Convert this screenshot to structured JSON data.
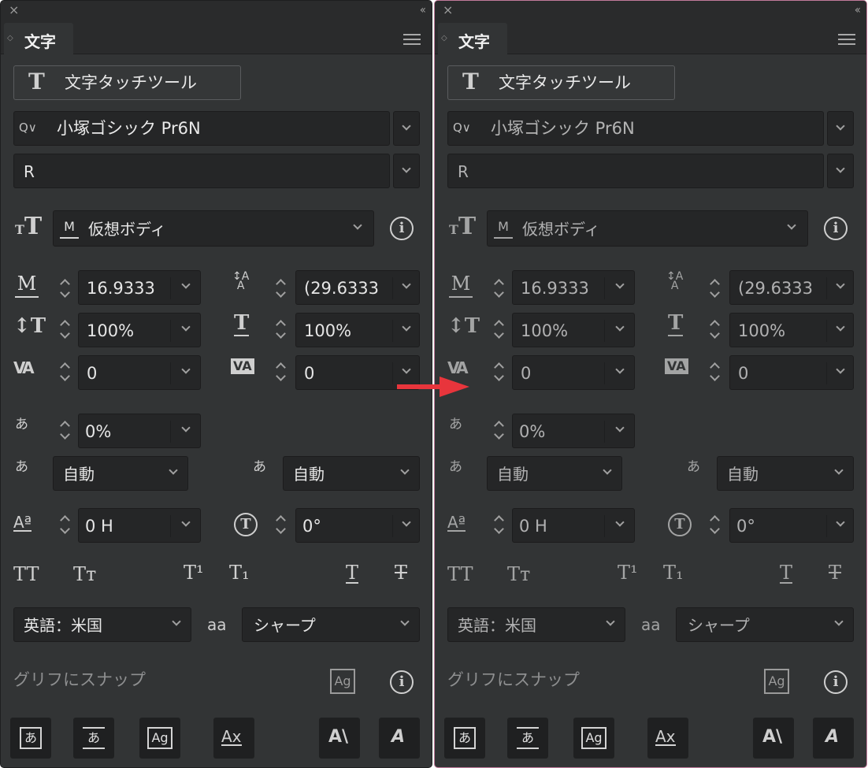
{
  "panels": [
    {
      "tab_label": "文字",
      "touch_tool_label": "文字タッチツール",
      "font_family": "小塚ゴシック Pr6N",
      "font_style": "R",
      "size_basis": "仮想ボディ",
      "font_size": "16.9333",
      "leading": "(29.6333",
      "vertical_scale": "100%",
      "horizontal_scale": "100%",
      "kerning": "0",
      "tracking": "0",
      "tsume": "0%",
      "aki_before": "自動",
      "aki_after": "自動",
      "baseline_shift": "0 H",
      "rotation": "0°",
      "language": "英語：米国",
      "antialias": "シャープ",
      "snap_label": "グリフにスナップ"
    },
    {
      "tab_label": "文字",
      "touch_tool_label": "文字タッチツール",
      "font_family": "小塚ゴシック Pr6N",
      "font_style": "R",
      "size_basis": "仮想ボディ",
      "font_size": "16.9333",
      "leading": "(29.6333",
      "vertical_scale": "100%",
      "horizontal_scale": "100%",
      "kerning": "0",
      "tracking": "0",
      "tsume": "0%",
      "aki_before": "自動",
      "aki_after": "自動",
      "baseline_shift": "0 H",
      "rotation": "0°",
      "language": "英語：米国",
      "antialias": "シャープ",
      "snap_label": "グリフにスナップ"
    }
  ],
  "icon_text": {
    "close": "×",
    "collapse": "‹‹",
    "search": "Q∨",
    "size_tt": "T",
    "size_tt_small": "T",
    "m_box": "M",
    "info": "i",
    "vert_scale": "↕T",
    "horiz_scale": "T",
    "kern": "VA",
    "track": "VA",
    "tsume": "あ",
    "aki_before": "あ",
    "aki_after": "あ",
    "baseline": "Aª",
    "rotate": "T",
    "aa": "aa",
    "glyph_ag": "Ag",
    "caps_all": "TT",
    "caps_small": "Tт",
    "superscript": "T¹",
    "subscript": "T₁",
    "underline": "T",
    "strike": "T",
    "btn_a1": "あ",
    "btn_a2": "あ",
    "btn_ag": "Ag",
    "btn_ax": "Ax",
    "btn_a_slash": "A\\",
    "btn_a_italic": "A"
  },
  "colors": {
    "panel_bg": "#323435",
    "field_bg": "#252627",
    "highlight_border": "#c07a9a",
    "arrow": "#e8353c"
  }
}
